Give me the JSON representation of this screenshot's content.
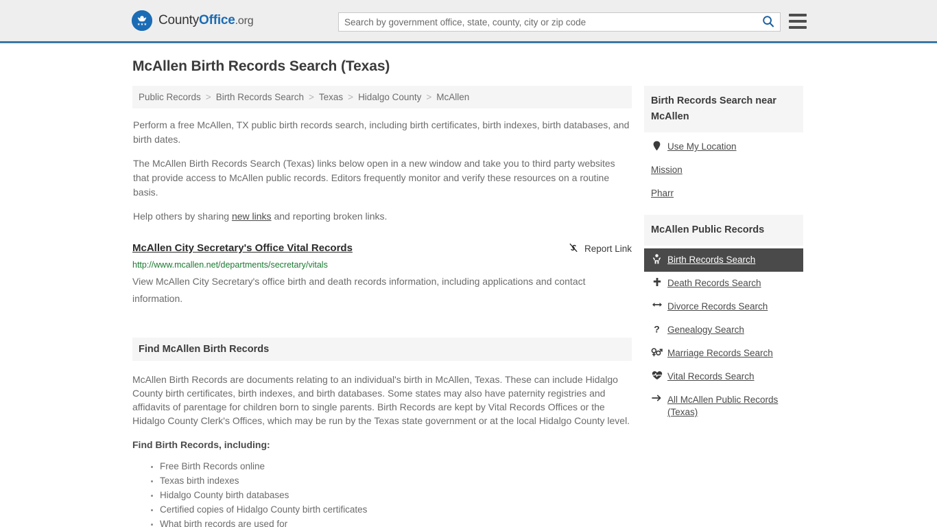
{
  "header": {
    "brand": {
      "part1": "County",
      "part2": "Office",
      "part3": ".org",
      "logo_icon": "eagle-stars-logo-icon"
    },
    "search": {
      "placeholder": "Search by government office, state, county, city or zip code",
      "value": "",
      "search_icon": "search-icon"
    },
    "menu_icon": "hamburger-menu-icon"
  },
  "page": {
    "title": "McAllen Birth Records Search (Texas)"
  },
  "breadcrumb": {
    "separator": ">",
    "items": [
      {
        "label": "Public Records"
      },
      {
        "label": "Birth Records Search"
      },
      {
        "label": "Texas"
      },
      {
        "label": "Hidalgo County"
      },
      {
        "label": "McAllen"
      }
    ]
  },
  "intro": {
    "p1": "Perform a free McAllen, TX public birth records search, including birth certificates, birth indexes, birth databases, and birth dates.",
    "p2": "The McAllen Birth Records Search (Texas) links below open in a new window and take you to third party websites that provide access to McAllen public records. Editors frequently monitor and verify these resources on a routine basis.",
    "p3_before": "Help others by sharing ",
    "p3_link": "new links",
    "p3_after": " and reporting broken links."
  },
  "result": {
    "title": "McAllen City Secretary's Office Vital Records",
    "url": "http://www.mcallen.net/departments/secretary/vitals",
    "description": "View McAllen City Secretary's office birth and death records information, including applications and contact information.",
    "report_label": "Report Link",
    "report_icon": "unlink-icon"
  },
  "section": {
    "heading": "Find McAllen Birth Records",
    "paragraph": "McAllen Birth Records are documents relating to an individual's birth in McAllen, Texas. These can include Hidalgo County birth certificates, birth indexes, and birth databases. Some states may also have paternity registries and affidavits of parentage for children born to single parents. Birth Records are kept by Vital Records Offices or the Hidalgo County Clerk's Offices, which may be run by the Texas state government or at the local Hidalgo County level.",
    "sub_heading": "Find Birth Records, including:",
    "bullets": [
      "Free Birth Records online",
      "Texas birth indexes",
      "Hidalgo County birth databases",
      "Certified copies of Hidalgo County birth certificates",
      "What birth records are used for"
    ]
  },
  "sidebar": {
    "near_panel": {
      "title": "Birth Records Search near McAllen",
      "items": [
        {
          "label": "Use My Location",
          "icon": "map-pin-icon",
          "has_icon": true
        },
        {
          "label": "Mission",
          "icon": "",
          "has_icon": false
        },
        {
          "label": "Pharr",
          "icon": "",
          "has_icon": false
        }
      ]
    },
    "records_panel": {
      "title": "McAllen Public Records",
      "items": [
        {
          "label": "Birth Records Search",
          "icon": "baby-icon",
          "active": true
        },
        {
          "label": "Death Records Search",
          "icon": "cross-plus-icon",
          "active": false
        },
        {
          "label": "Divorce Records Search",
          "icon": "left-right-arrow-icon",
          "active": false
        },
        {
          "label": "Genealogy Search",
          "icon": "question-mark-icon",
          "active": false
        },
        {
          "label": "Marriage Records Search",
          "icon": "venus-mars-icon",
          "active": false
        },
        {
          "label": "Vital Records Search",
          "icon": "heartbeat-icon",
          "active": false
        },
        {
          "label": "All McAllen Public Records (Texas)",
          "icon": "arrow-right-icon",
          "active": false
        }
      ]
    }
  },
  "colors": {
    "brand_blue": "#1b6cb5",
    "header_bg": "#eeeeee",
    "header_rule": "#3a78a8",
    "panel_bg": "#f5f5f5",
    "active_bg": "#4a4a4a",
    "url_green": "#1d7a33",
    "text_gray": "#6b6b6b"
  }
}
